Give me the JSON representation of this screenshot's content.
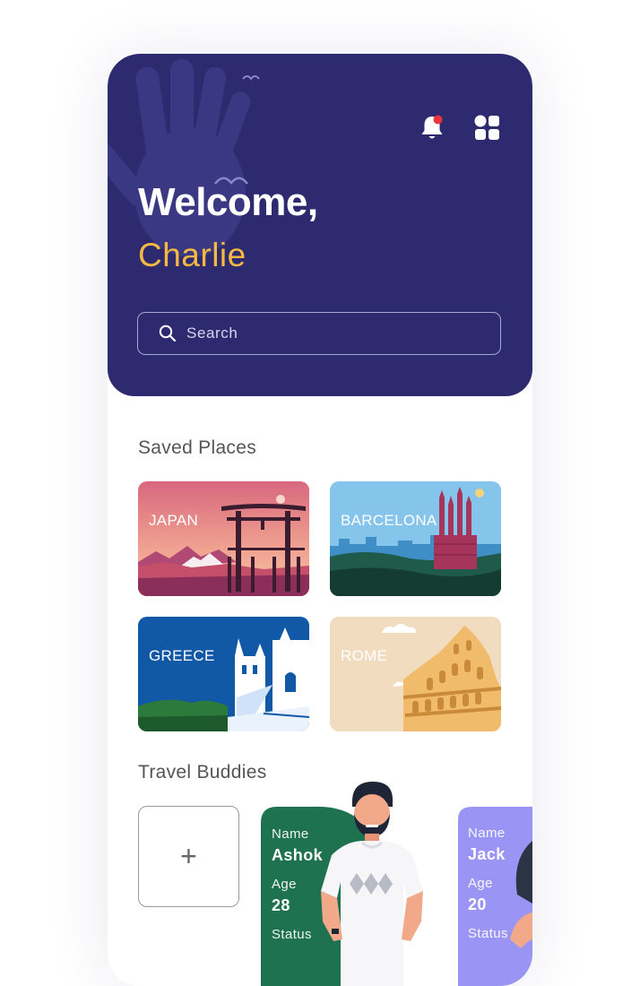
{
  "header": {
    "greeting": "Welcome,",
    "user_name": "Charlie",
    "notification_icon": "bell-icon",
    "menu_icon": "grid-menu-icon",
    "has_unread_notification": true
  },
  "search": {
    "placeholder": "Search",
    "icon": "search-icon"
  },
  "saved_places": {
    "title": "Saved Places",
    "items": [
      {
        "label": "JAPAN"
      },
      {
        "label": "BARCELONA"
      },
      {
        "label": "GREECE"
      },
      {
        "label": "ROME"
      }
    ]
  },
  "travel_buddies": {
    "title": "Travel Buddies",
    "add_label": "+",
    "buddies": [
      {
        "name_label": "Name",
        "name": "Ashok",
        "age_label": "Age",
        "age": "28",
        "status_label": "Status"
      },
      {
        "name_label": "Name",
        "name": "Jack",
        "age_label": "Age",
        "age": "20",
        "status_label": "Status"
      }
    ]
  },
  "colors": {
    "header_bg": "#2e2a6f",
    "accent_yellow": "#f4b843",
    "notification_dot": "#e8343a",
    "buddy_green": "#1f7250",
    "buddy_purple": "#9a95f5"
  }
}
